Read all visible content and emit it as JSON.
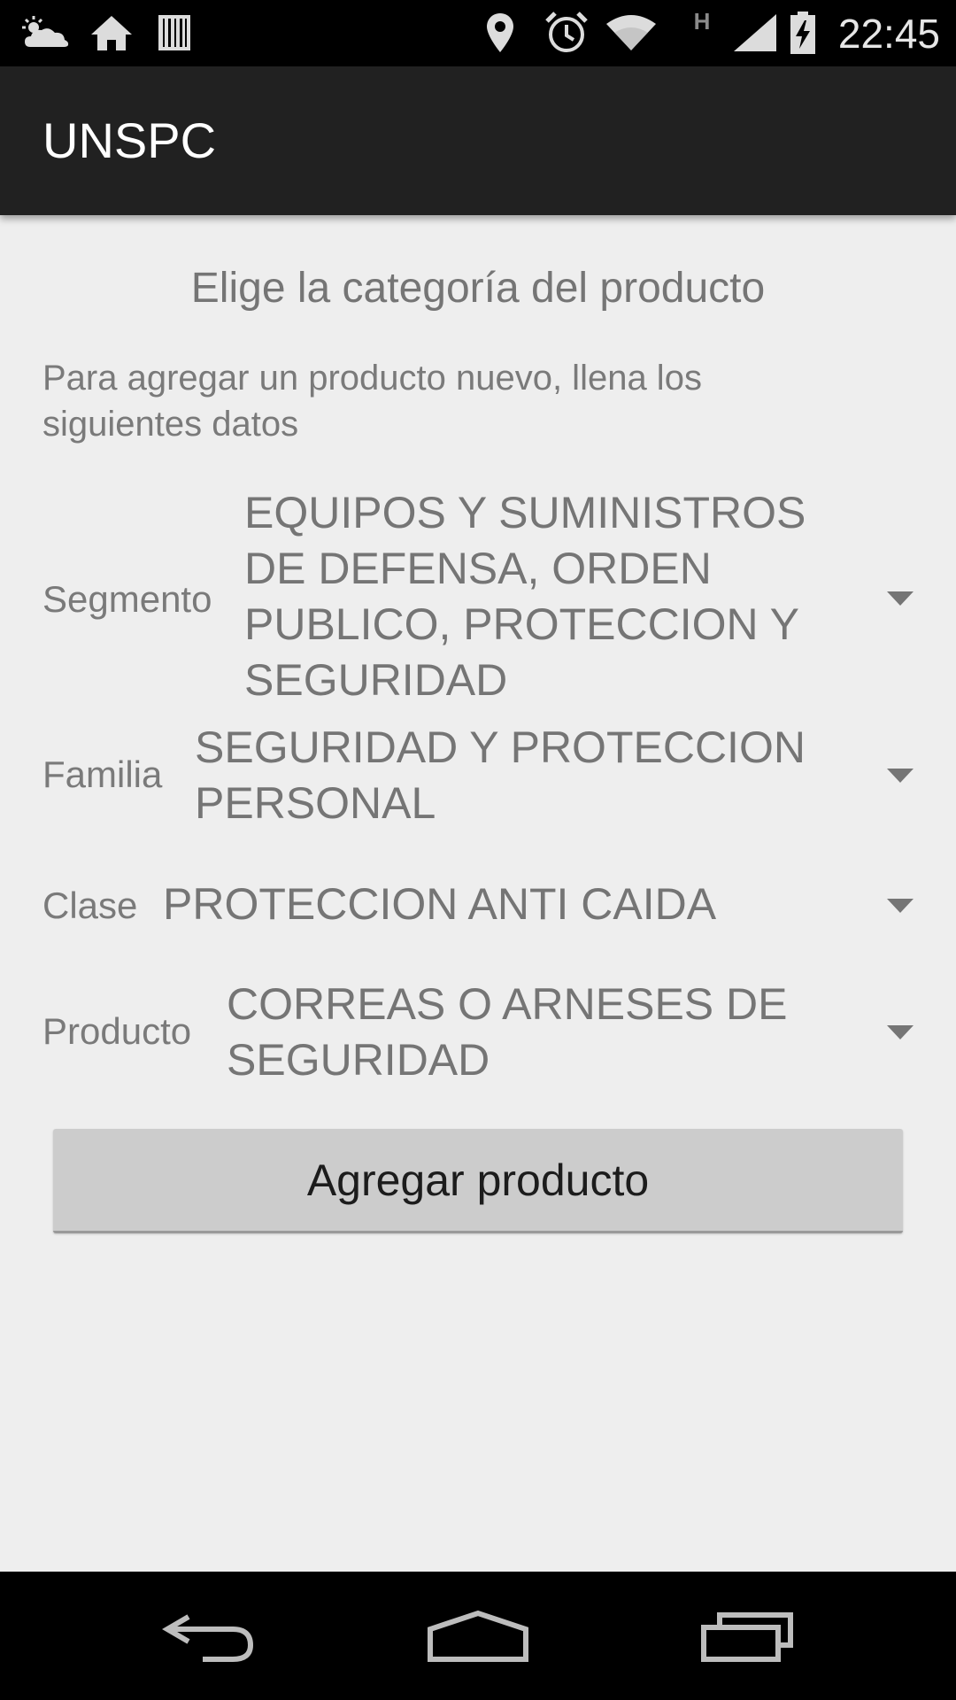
{
  "status_bar": {
    "time": "22:45",
    "network_label": "H",
    "left_icons": [
      "weather-icon",
      "home-icon",
      "barcode-icon"
    ],
    "right_icons": [
      "location-icon",
      "alarm-icon",
      "wifi-icon",
      "signal-icon",
      "battery-charging-icon"
    ]
  },
  "action_bar": {
    "title": "UNSPC"
  },
  "form": {
    "heading": "Elige la categoría del producto",
    "intro": "Para agregar un producto nuevo, llena los siguientes datos",
    "fields": [
      {
        "label": "Segmento",
        "value": "EQUIPOS Y SUMINISTROS DE DEFENSA, ORDEN PUBLICO, PROTECCION Y SEGURIDAD"
      },
      {
        "label": "Familia",
        "value": "SEGURIDAD Y PROTECCION PERSONAL"
      },
      {
        "label": "Clase",
        "value": "PROTECCION ANTI CAIDA"
      },
      {
        "label": "Producto",
        "value": "CORREAS O ARNESES DE SEGURIDAD"
      }
    ],
    "submit_label": "Agregar producto"
  },
  "nav_bar": {
    "buttons": [
      "back-icon",
      "home-nav-icon",
      "recents-icon"
    ]
  },
  "colors": {
    "status_bar_bg": "#000000",
    "action_bar_bg": "#212121",
    "content_bg": "#eeeeee",
    "text_gray": "#757575",
    "button_bg": "#cccccc"
  }
}
